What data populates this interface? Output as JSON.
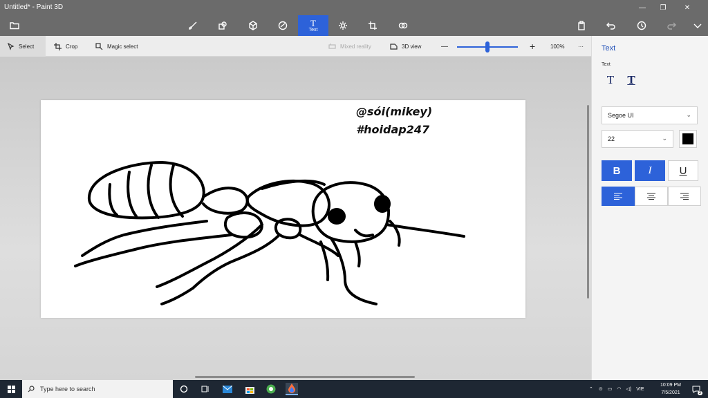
{
  "window": {
    "title": "Untitled* - Paint 3D"
  },
  "toolbar": {
    "tools": [
      "folder-icon",
      "brush-icon",
      "2d-shapes-icon",
      "3d-shapes-icon",
      "stickers-icon",
      "text-icon",
      "effects-icon",
      "canvas-icon",
      "3d-library-icon"
    ],
    "active_label": "Text",
    "active_glyph": "T"
  },
  "subbar": {
    "select_label": "Select",
    "crop_label": "Crop",
    "magic_select_label": "Magic select",
    "mixed_reality_label": "Mixed reality",
    "view3d_label": "3D view",
    "zoom_out": "—",
    "zoom_in": "+",
    "zoom_value": "100%",
    "more": "···"
  },
  "canvas": {
    "line1": "@sói(mikey)",
    "line2": "#hoidap247"
  },
  "panel": {
    "title": "Text",
    "subtitle": "Text",
    "font_family": "Segoe UI",
    "font_size": "22",
    "text_color": "#000000",
    "bold": "B",
    "italic": "I",
    "underline": "U",
    "bold_on": true,
    "italic_on": true,
    "underline_on": false,
    "alignment": "left"
  },
  "taskbar": {
    "search_placeholder": "Type here to search",
    "language": "VIE",
    "time": "10:09 PM",
    "date": "7/5/2021",
    "notification_count": "3"
  },
  "colors": {
    "accent": "#2d62d9",
    "titlebar": "#6b6b6b",
    "taskbar": "#1e2733"
  }
}
